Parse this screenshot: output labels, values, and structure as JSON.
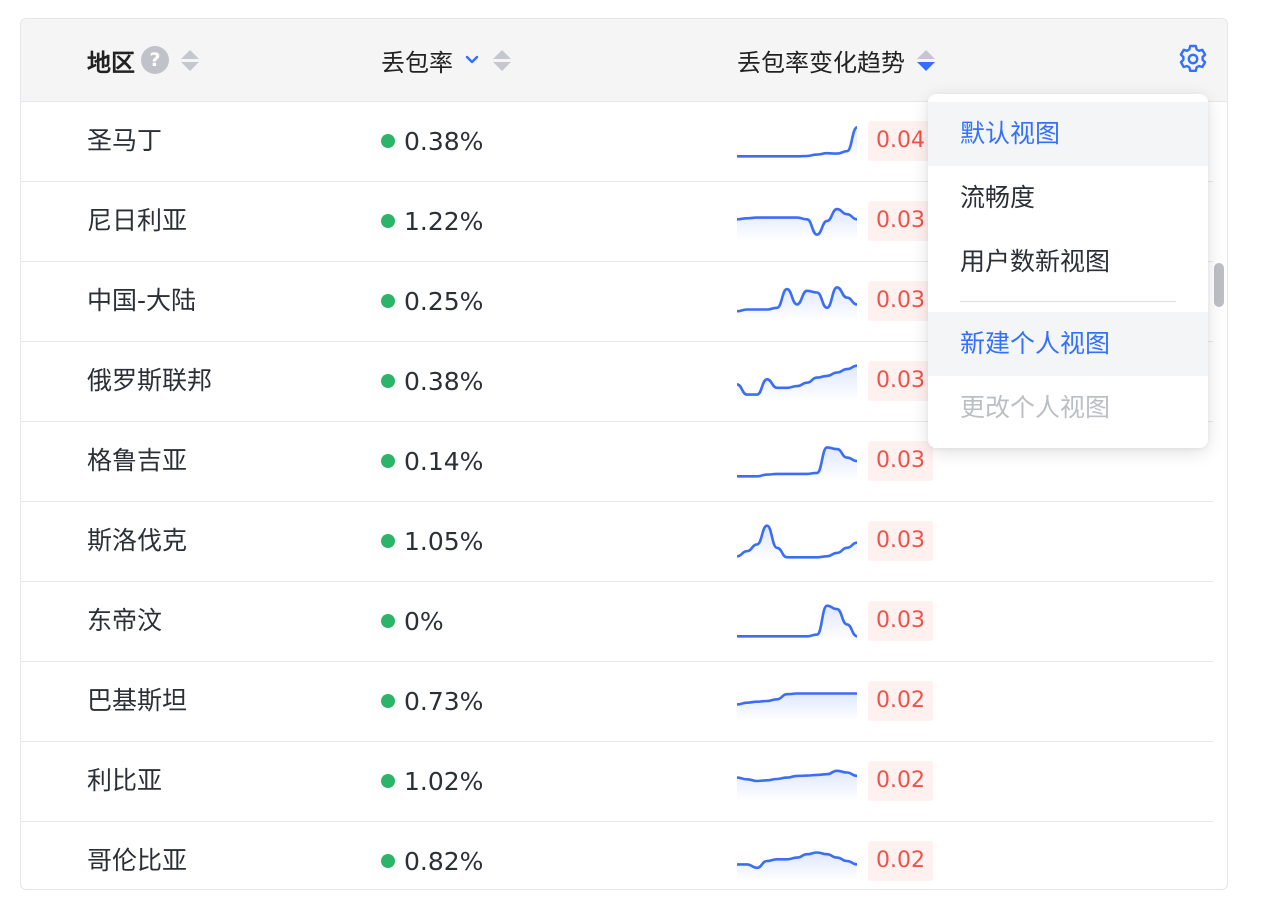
{
  "header": {
    "region": "地区",
    "help_icon": "?",
    "loss_rate": "丢包率",
    "trend": "丢包率变化趋势"
  },
  "colors": {
    "accent": "#3370ff",
    "good": "#2ab56a",
    "bad": "#f0524a",
    "spark_line": "#3b6ef5"
  },
  "rows": [
    {
      "region": "圣马丁",
      "loss": "0.38%",
      "badge": "0.04",
      "trend": [
        0.05,
        0.05,
        0.05,
        0.05,
        0.05,
        0.05,
        0.05,
        0.06,
        0.1,
        0.14,
        0.13,
        0.2,
        0.9
      ]
    },
    {
      "region": "尼日利亚",
      "loss": "1.22%",
      "badge": "0.03",
      "trend": [
        0.55,
        0.58,
        0.6,
        0.6,
        0.6,
        0.6,
        0.6,
        0.55,
        0.1,
        0.5,
        0.85,
        0.7,
        0.55
      ]
    },
    {
      "region": "中国-大陆",
      "loss": "0.25%",
      "badge": "0.03",
      "trend": [
        0.2,
        0.25,
        0.25,
        0.25,
        0.3,
        0.85,
        0.4,
        0.8,
        0.75,
        0.3,
        0.9,
        0.6,
        0.4
      ]
    },
    {
      "region": "俄罗斯联邦",
      "loss": "0.38%",
      "badge": "0.03",
      "trend": [
        0.4,
        0.1,
        0.1,
        0.55,
        0.3,
        0.3,
        0.35,
        0.45,
        0.6,
        0.65,
        0.75,
        0.85,
        0.95
      ]
    },
    {
      "region": "格鲁吉亚",
      "loss": "0.14%",
      "badge": "0.03",
      "trend": [
        0.05,
        0.05,
        0.05,
        0.1,
        0.12,
        0.12,
        0.12,
        0.12,
        0.15,
        0.9,
        0.85,
        0.6,
        0.5
      ]
    },
    {
      "region": "斯洛伐克",
      "loss": "1.05%",
      "badge": "0.03",
      "trend": [
        0.05,
        0.2,
        0.4,
        0.95,
        0.3,
        0.02,
        0.02,
        0.02,
        0.02,
        0.05,
        0.15,
        0.3,
        0.45
      ]
    },
    {
      "region": "东帝汶",
      "loss": "0%",
      "badge": "0.03",
      "trend": [
        0.05,
        0.05,
        0.05,
        0.05,
        0.05,
        0.05,
        0.05,
        0.05,
        0.1,
        0.95,
        0.85,
        0.4,
        0.05
      ]
    },
    {
      "region": "巴基斯坦",
      "loss": "0.73%",
      "badge": "0.02",
      "trend": [
        0.4,
        0.45,
        0.48,
        0.5,
        0.55,
        0.7,
        0.72,
        0.72,
        0.72,
        0.72,
        0.72,
        0.72,
        0.72
      ]
    },
    {
      "region": "利比亚",
      "loss": "1.02%",
      "badge": "0.02",
      "trend": [
        0.6,
        0.55,
        0.5,
        0.52,
        0.56,
        0.6,
        0.65,
        0.66,
        0.68,
        0.7,
        0.8,
        0.75,
        0.65
      ]
    },
    {
      "region": "哥伦比亚",
      "loss": "0.82%",
      "badge": "0.02",
      "trend": [
        0.4,
        0.4,
        0.3,
        0.5,
        0.55,
        0.55,
        0.6,
        0.7,
        0.75,
        0.7,
        0.6,
        0.5,
        0.4
      ]
    }
  ],
  "menu": {
    "items": [
      {
        "label": "默认视图",
        "state": "selected"
      },
      {
        "label": "流畅度",
        "state": "normal"
      },
      {
        "label": "用户数新视图",
        "state": "normal"
      },
      {
        "label": "新建个人视图",
        "state": "hover"
      },
      {
        "label": "更改个人视图",
        "state": "disabled"
      }
    ]
  }
}
